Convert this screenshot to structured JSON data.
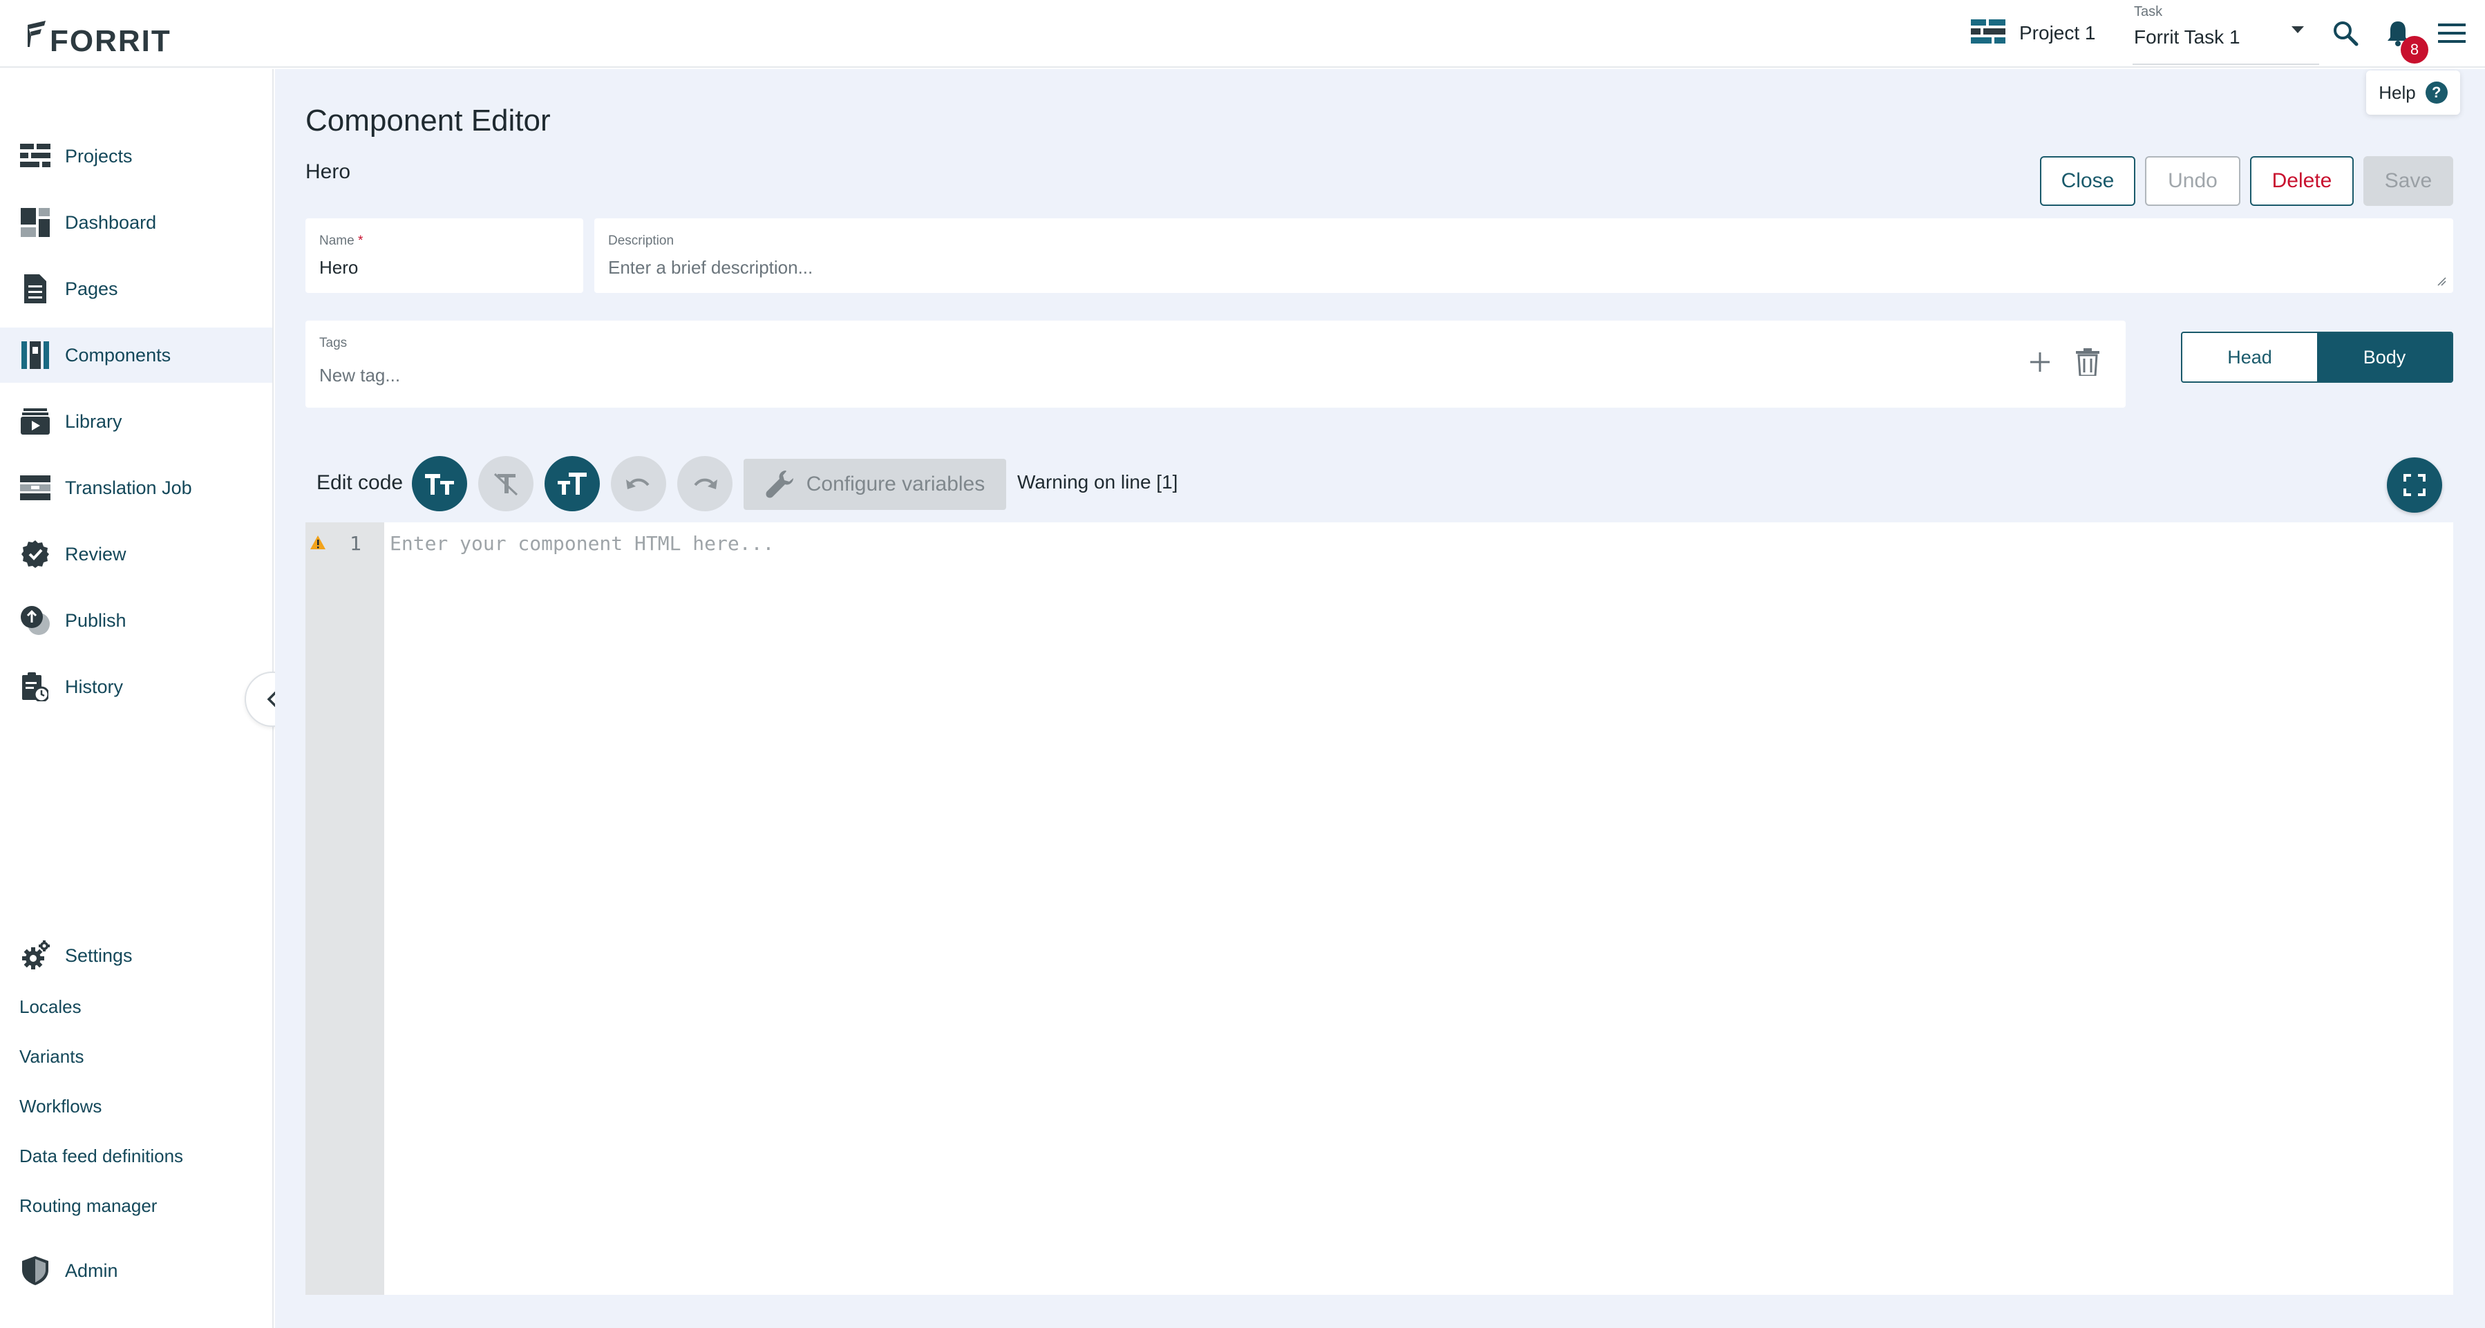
{
  "header": {
    "logo_text": "FORRIT",
    "project": "Project 1",
    "task_label": "Task",
    "task_value": "Forrit Task 1",
    "notification_count": "8"
  },
  "sidebar": {
    "items": [
      {
        "label": "Projects",
        "icon": "projects-icon"
      },
      {
        "label": "Dashboard",
        "icon": "dashboard-icon"
      },
      {
        "label": "Pages",
        "icon": "pages-icon"
      },
      {
        "label": "Components",
        "icon": "components-icon",
        "active": true
      },
      {
        "label": "Library",
        "icon": "library-icon"
      },
      {
        "label": "Translation Job",
        "icon": "translation-job-icon"
      },
      {
        "label": "Review",
        "icon": "review-icon"
      },
      {
        "label": "Publish",
        "icon": "publish-icon"
      },
      {
        "label": "History",
        "icon": "history-icon"
      }
    ],
    "settings": {
      "label": "Settings",
      "icon": "gear-icon"
    },
    "settings_sub": [
      "Locales",
      "Variants",
      "Workflows",
      "Data feed definitions",
      "Routing manager"
    ],
    "admin": {
      "label": "Admin",
      "icon": "admin-shield-icon"
    }
  },
  "page": {
    "help_label": "Help",
    "title": "Component Editor",
    "subtitle": "Hero",
    "buttons": {
      "close": "Close",
      "undo": "Undo",
      "delete": "Delete",
      "save": "Save"
    }
  },
  "form": {
    "name_label": "Name",
    "name_value": "Hero",
    "description_label": "Description",
    "description_placeholder": "Enter a brief description...",
    "tags_label": "Tags",
    "tags_placeholder": "New tag..."
  },
  "section_toggle": {
    "options": [
      "Head",
      "Body"
    ],
    "selected": "Body"
  },
  "editor": {
    "edit_code_label": "Edit code",
    "configure_variables_label": "Configure variables",
    "warning_text": "Warning on line [1]",
    "line_number": "1",
    "placeholder": "Enter your component HTML here..."
  },
  "colors": {
    "accent": "#14566a",
    "danger": "#c8102e",
    "main_bg": "#eef2fa",
    "link": "#14485a"
  }
}
